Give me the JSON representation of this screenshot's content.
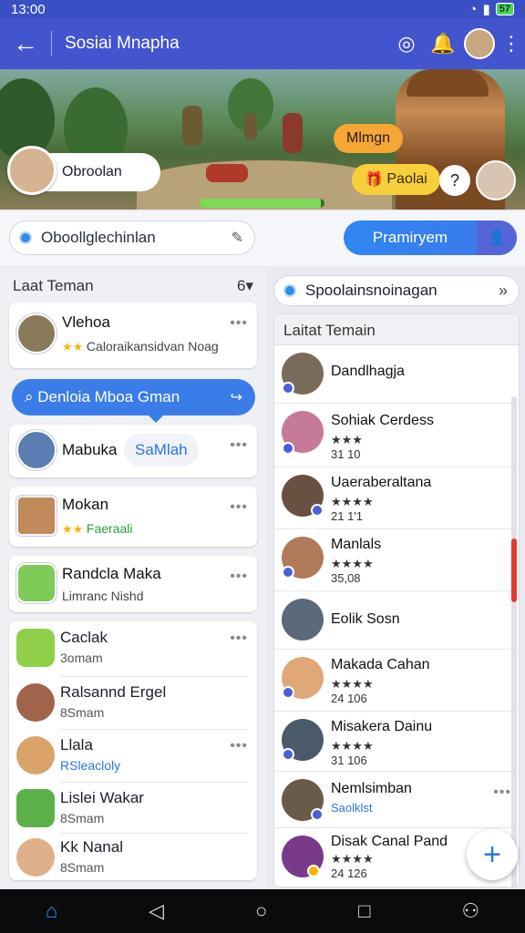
{
  "status": {
    "time": "13:00",
    "battery": "57"
  },
  "appbar": {
    "title": "Sosiai Mnapha"
  },
  "hero": {
    "user_chip": "Obroolan",
    "badge_orange": "Mlmgn",
    "badge_yellow": "Paolai",
    "help": "?",
    "progress": 0.97
  },
  "search": {
    "placeholder": "Oboollglechinlan",
    "primary_button": "Pramiryem"
  },
  "left": {
    "header": "Laat Teman",
    "count": "6",
    "cards": [
      {
        "name": "Vlehoa",
        "sub": "Caloraikansidvan Noag"
      },
      {
        "name": "Mabuka",
        "tag": "SaMlah"
      },
      {
        "name": "Mokan",
        "sub": "Faeraali"
      },
      {
        "name": "Randcla Maka",
        "sub": "Limranc Nishd"
      }
    ],
    "blue_prompt": "Denloia Mboa Gman",
    "group": [
      {
        "name": "Caclak",
        "sub": "3omam"
      },
      {
        "name": "Ralsannd Ergel",
        "sub": "8Smam"
      },
      {
        "name": "Llala",
        "sub": "RSleacloly"
      },
      {
        "name": "Lislei",
        "name2": "Wakar",
        "sub": "8Smam"
      },
      {
        "name": "Kk",
        "name2": "Nanal",
        "sub": "8Smam"
      }
    ]
  },
  "right": {
    "sponsor": "Spoolainsnoinagan",
    "list_header": "Laitat Temain",
    "items": [
      {
        "name": "Dandlhagja",
        "stars": "",
        "num": ""
      },
      {
        "name": "Sohiak Cerdess",
        "stars": "★★★",
        "num": "31 10"
      },
      {
        "name": "Uaeraberaltana",
        "stars": "★★★★",
        "num": "21 1'1"
      },
      {
        "name": "Manlals",
        "stars": "★★★★",
        "num": "35,08"
      },
      {
        "name": "Eolik Sosn",
        "stars": "",
        "num": ""
      },
      {
        "name": "Makada Cahan",
        "stars": "★★★★",
        "num": "24 106"
      },
      {
        "name": "Misakera Dainu",
        "stars": "★★★★",
        "num": "31 106"
      },
      {
        "name": "Nemlsimban",
        "stars": "",
        "num": "",
        "sub": "Saolklst"
      },
      {
        "name": "Disak Canal Pand",
        "stars": "★★★★",
        "num": "24 126"
      }
    ]
  },
  "icons": {
    "back": "arrow-left-icon",
    "chat": "chat-icon",
    "notify": "bell-icon",
    "menu": "more-vert-icon",
    "search": "search-icon",
    "fab": "plus-icon"
  },
  "colors": {
    "primary": "#4354cf",
    "accent_blue": "#3a7de8",
    "orange": "#f5a634",
    "yellow": "#f7cf3b",
    "star": "#f5b800"
  }
}
